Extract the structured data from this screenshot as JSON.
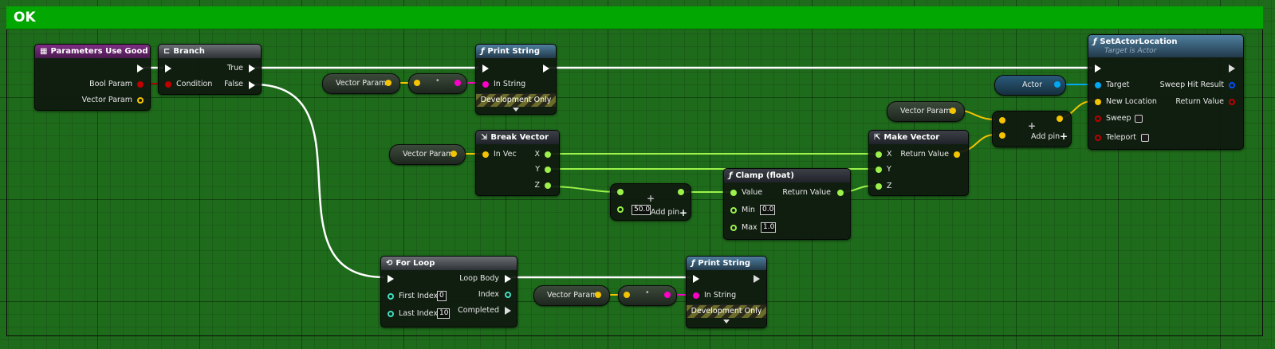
{
  "banner": {
    "title": "OK"
  },
  "colors": {
    "exec": "#ffffff",
    "bool": "#c00000",
    "vector": "#f5c400",
    "float": "#9cf24a",
    "string": "#ff00c8",
    "object": "#00a8f3",
    "struct": "#0050ff",
    "int": "#40e0c0"
  },
  "nodes": {
    "event": {
      "title": "Parameters Use Good",
      "bool_param": "Bool Param",
      "vector_param": "Vector Param"
    },
    "branch": {
      "title": "Branch",
      "condition": "Condition",
      "true_label": "True",
      "false_label": "False"
    },
    "print1": {
      "title": "Print String",
      "in_string": "In String",
      "dev_only": "Development Only"
    },
    "vec_param_1": {
      "label": "Vector Param"
    },
    "vec_param_2": {
      "label": "Vector Param"
    },
    "vec_param_3": {
      "label": "Vector Param"
    },
    "vec_param_4": {
      "label": "Vector Param"
    },
    "break_vector": {
      "title": "Break Vector",
      "in_vec": "In Vec",
      "x": "X",
      "y": "Y",
      "z": "Z"
    },
    "add_float": {
      "value": "50.0",
      "add_pin": "Add pin"
    },
    "clamp": {
      "title": "Clamp (float)",
      "value": "Value",
      "min": "Min",
      "min_value": "0.0",
      "max": "Max",
      "max_value": "1.0",
      "return_value": "Return Value"
    },
    "make_vector": {
      "title": "Make Vector",
      "x": "X",
      "y": "Y",
      "z": "Z",
      "return_value": "Return Value"
    },
    "add_vector": {
      "add_pin": "Add pin"
    },
    "actor": {
      "label": "Actor"
    },
    "set_actor_location": {
      "title": "SetActorLocation",
      "subtitle": "Target is Actor",
      "target": "Target",
      "new_location": "New Location",
      "sweep": "Sweep",
      "teleport": "Teleport",
      "sweep_hit_result": "Sweep Hit Result",
      "return_value": "Return Value"
    },
    "for_loop": {
      "title": "For Loop",
      "first_index": "First Index",
      "first_value": "0",
      "last_index": "Last Index",
      "last_value": "10",
      "loop_body": "Loop Body",
      "index": "Index",
      "completed": "Completed"
    },
    "print2": {
      "title": "Print String",
      "in_string": "In String",
      "dev_only": "Development Only"
    }
  }
}
